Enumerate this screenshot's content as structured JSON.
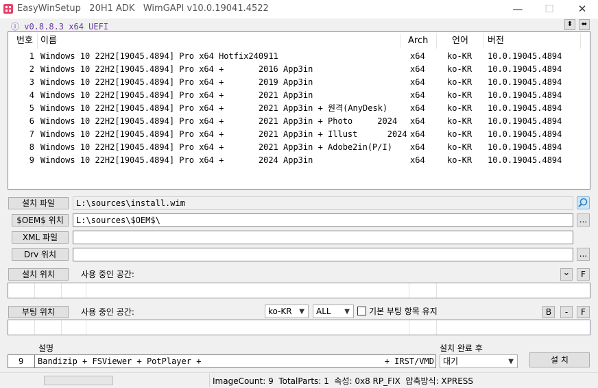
{
  "window": {
    "title": "EasyWinSetup   20H1 ADK   WimGAPI v10.0.19041.4522",
    "min_glyph": "—",
    "max_glyph": "☐",
    "close_glyph": "✕"
  },
  "version": {
    "label": "ⓘ v0.8.8.3 x64 UEFI",
    "btn_updown": "⬍",
    "btn_leftright": "⬌"
  },
  "columns": {
    "num": "번호",
    "name": "이름",
    "arch": "Arch",
    "lang": "언어",
    "ver": "버전"
  },
  "images": [
    {
      "num": "1",
      "name": "Windows 10 22H2[19045.4894] Pro x64 Hotfix240911",
      "arch": "x64",
      "lang": "ko-KR",
      "ver": "10.0.19045.4894"
    },
    {
      "num": "2",
      "name": "Windows 10 22H2[19045.4894] Pro x64 +       2016 App3in",
      "arch": "x64",
      "lang": "ko-KR",
      "ver": "10.0.19045.4894"
    },
    {
      "num": "3",
      "name": "Windows 10 22H2[19045.4894] Pro x64 +       2019 App3in",
      "arch": "x64",
      "lang": "ko-KR",
      "ver": "10.0.19045.4894"
    },
    {
      "num": "4",
      "name": "Windows 10 22H2[19045.4894] Pro x64 +       2021 App3in",
      "arch": "x64",
      "lang": "ko-KR",
      "ver": "10.0.19045.4894"
    },
    {
      "num": "5",
      "name": "Windows 10 22H2[19045.4894] Pro x64 +       2021 App3in + 원격(AnyDesk)",
      "arch": "x64",
      "lang": "ko-KR",
      "ver": "10.0.19045.4894"
    },
    {
      "num": "6",
      "name": "Windows 10 22H2[19045.4894] Pro x64 +       2021 App3in + Photo     2024",
      "arch": "x64",
      "lang": "ko-KR",
      "ver": "10.0.19045.4894"
    },
    {
      "num": "7",
      "name": "Windows 10 22H2[19045.4894] Pro x64 +       2021 App3in + Illust      2024",
      "arch": "x64",
      "lang": "ko-KR",
      "ver": "10.0.19045.4894"
    },
    {
      "num": "8",
      "name": "Windows 10 22H2[19045.4894] Pro x64 +       2021 App3in + Adobe2in(P/I)",
      "arch": "x64",
      "lang": "ko-KR",
      "ver": "10.0.19045.4894"
    },
    {
      "num": "9",
      "name": "Windows 10 22H2[19045.4894] Pro x64 +       2024 App3in",
      "arch": "x64",
      "lang": "ko-KR",
      "ver": "10.0.19045.4894"
    }
  ],
  "fields": {
    "install_file": {
      "button": "설치 파일",
      "value": "L:\\sources\\install.wim"
    },
    "oem": {
      "button": "$OEM$ 위치",
      "value": "L:\\sources\\$OEM$\\"
    },
    "xml": {
      "button": "XML 파일",
      "value": ""
    },
    "drv": {
      "button": "Drv 위치",
      "value": ""
    },
    "browse": "..."
  },
  "install_location": {
    "button": "설치 위치",
    "used_label": "사용 중인 공간:",
    "dropdown": "⌄",
    "f_btn": "F"
  },
  "boot_location": {
    "button": "부팅 위치",
    "used_label": "사용 중인 공간:",
    "lang_select": "ko-KR",
    "scope_select": "ALL",
    "keep_boot_label": "기본 부팅 항목 유지",
    "b_btn": "B",
    "minus_btn": "-",
    "f_btn": "F"
  },
  "bottom": {
    "desc_label": "설명",
    "index": "9",
    "description": "Bandizip + FSViewer + PotPlayer +                                     + IRST/VMD Dri",
    "after_label": "설치 완료 후",
    "after_select": "대기",
    "install_button": "설 치"
  },
  "status": {
    "text": "ImageCount: 9  TotalParts: 1  속성: 0x8 RP_FIX  압축방식: XPRESS"
  }
}
